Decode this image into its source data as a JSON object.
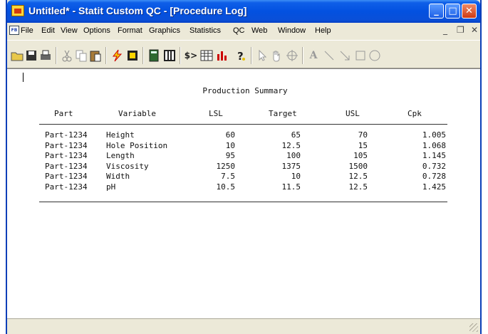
{
  "window": {
    "title": "Untitled* - Statit Custom QC - [Procedure Log]",
    "minimize": "_",
    "maximize": "□",
    "close": "✕"
  },
  "menu": {
    "doc_icon": "FB",
    "items": [
      "File",
      "Edit",
      "View",
      "Options",
      "Format",
      "Graphics",
      "Statistics",
      "QC",
      "Web",
      "Window",
      "Help"
    ],
    "mdi_min": "_",
    "mdi_restore": "❐",
    "mdi_close": "✕"
  },
  "toolbar": {
    "icons": [
      "open-icon",
      "save-icon",
      "print-icon",
      "cut-icon",
      "copy-icon",
      "paste-icon",
      "run-icon",
      "data-icon",
      "calculator-icon",
      "column-icon",
      "script-icon",
      "table-icon",
      "chart-icon",
      "help-icon",
      "pointer-icon",
      "hand-icon",
      "target-icon",
      "text-icon",
      "line-icon",
      "arrow-line-icon",
      "rectangle-icon",
      "ellipse-icon"
    ]
  },
  "report": {
    "title": "Production Summary",
    "columns": [
      "Part",
      "Variable",
      "LSL",
      "Target",
      "USL",
      "Cpk"
    ],
    "rows": [
      [
        "Part-1234",
        "Height",
        "60",
        "65",
        "70",
        "1.005"
      ],
      [
        "Part-1234",
        "Hole Position",
        "10",
        "12.5",
        "15",
        "1.068"
      ],
      [
        "Part-1234",
        "Length",
        "95",
        "100",
        "105",
        "1.145"
      ],
      [
        "Part-1234",
        "Viscosity",
        "1250",
        "1375",
        "1500",
        "0.732"
      ],
      [
        "Part-1234",
        "Width",
        "7.5",
        "10",
        "12.5",
        "0.728"
      ],
      [
        "Part-1234",
        "pH",
        "10.5",
        "11.5",
        "12.5",
        "1.425"
      ]
    ]
  }
}
